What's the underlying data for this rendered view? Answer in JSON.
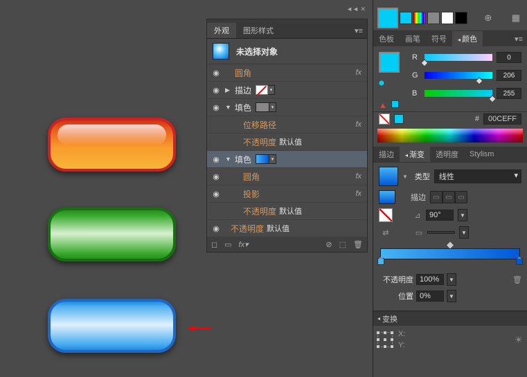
{
  "appearance_panel": {
    "tab_appearance": "外观",
    "tab_styles": "图形样式",
    "header_label": "未选择对象",
    "row_round": "圆角",
    "row_stroke": "描边",
    "row_fill": "填色",
    "row_offset": "位移路径",
    "row_opacity": "不透明度",
    "row_default": "默认值",
    "row_round2": "圆角",
    "row_shadow": "投影",
    "fx_label": "fx"
  },
  "toolbar": {
    "colors": [
      "#00cef6",
      "#00cef6",
      "#ea3030",
      "#ffbb00",
      "#55cc33",
      "#2288ee",
      "#aa55dd",
      "#888",
      "#fff",
      "#000"
    ]
  },
  "tabs1": {
    "swatches": "色板",
    "brushes": "画笔",
    "symbols": "符号",
    "color": "颜色"
  },
  "color_panel": {
    "r_label": "R",
    "g_label": "G",
    "b_label": "B",
    "r_val": "0",
    "g_val": "206",
    "b_val": "255",
    "hex_prefix": "#",
    "hex_val": "00CEFF"
  },
  "tabs2": {
    "stroke": "描边",
    "gradient": "渐变",
    "transparency": "透明度",
    "stylism": "Stylism"
  },
  "gradient_panel": {
    "type_label": "类型",
    "type_value": "线性",
    "stroke_label": "描边",
    "angle_value": "90°",
    "opacity_label": "不透明度",
    "opacity_value": "100%",
    "location_label": "位置",
    "location_value": "0%"
  },
  "transform": {
    "label": "变换",
    "x": "X:",
    "y": "Y:"
  }
}
